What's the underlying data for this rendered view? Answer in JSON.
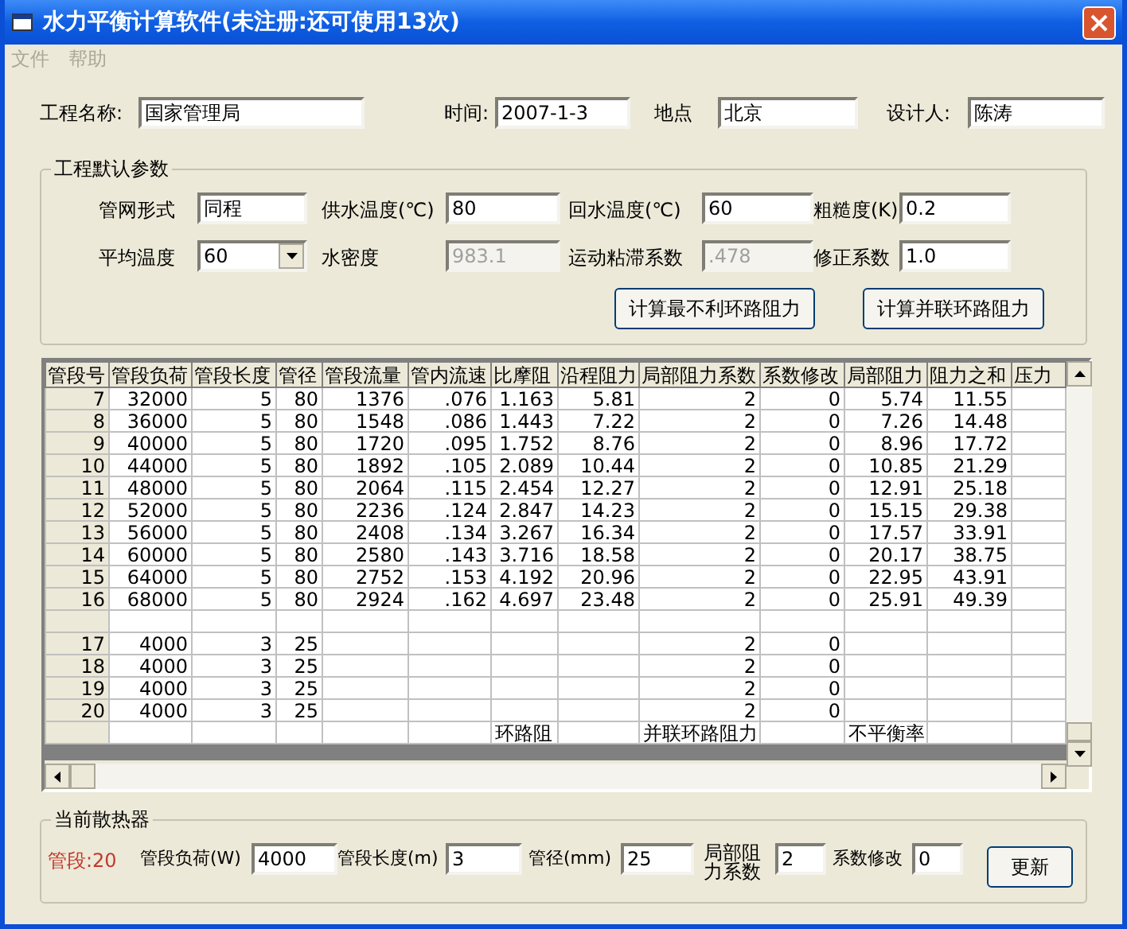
{
  "window": {
    "title": "水力平衡计算软件(未注册:还可使用13次)"
  },
  "menu": [
    {
      "label": "文件",
      "disabled": true
    },
    {
      "label": "帮助",
      "disabled": true
    }
  ],
  "project": [
    {
      "label": "工程名称:",
      "value": "国家管理局"
    },
    {
      "label": "时间:",
      "value": "2007-1-3"
    },
    {
      "label": "地点",
      "value": "北京"
    },
    {
      "label": "设计人:",
      "value": "陈涛"
    }
  ],
  "defaults": {
    "title": "工程默认参数",
    "fields": [
      {
        "kind": "text",
        "label": "管网形式",
        "value": "同程",
        "disabled": false
      },
      {
        "kind": "text",
        "label": "供水温度(℃)",
        "value": "80",
        "disabled": false
      },
      {
        "kind": "text",
        "label": "回水温度(℃)",
        "value": "60",
        "disabled": false
      },
      {
        "kind": "text",
        "label": "粗糙度(K)",
        "value": "0.2",
        "disabled": false
      },
      {
        "kind": "select",
        "label": "平均温度",
        "value": "60",
        "disabled": false
      },
      {
        "kind": "text",
        "label": "水密度",
        "value": "983.1",
        "disabled": true
      },
      {
        "kind": "text",
        "label": "运动粘滞系数",
        "value": ".478",
        "disabled": true
      },
      {
        "kind": "text",
        "label": "修正系数",
        "value": "1.0",
        "disabled": false
      }
    ],
    "buttons": [
      "计算最不利环路阻力",
      "计算并联环路阻力"
    ]
  },
  "table": {
    "columns": [
      "管段号",
      "管段负荷",
      "管段长度",
      "管径",
      "管段流量",
      "管内流速",
      "比摩阻",
      "沿程阻力",
      "局部阻力系数",
      "系数修改",
      "局部阻力",
      "阻力之和",
      "压力"
    ],
    "rows": [
      [
        "7",
        "32000",
        "5",
        "80",
        "1376",
        ".076",
        "1.163",
        "5.81",
        "2",
        "0",
        "5.74",
        "11.55",
        null
      ],
      [
        "8",
        "36000",
        "5",
        "80",
        "1548",
        ".086",
        "1.443",
        "7.22",
        "2",
        "0",
        "7.26",
        "14.48",
        null
      ],
      [
        "9",
        "40000",
        "5",
        "80",
        "1720",
        ".095",
        "1.752",
        "8.76",
        "2",
        "0",
        "8.96",
        "17.72",
        null
      ],
      [
        "10",
        "44000",
        "5",
        "80",
        "1892",
        ".105",
        "2.089",
        "10.44",
        "2",
        "0",
        "10.85",
        "21.29",
        null
      ],
      [
        "11",
        "48000",
        "5",
        "80",
        "2064",
        ".115",
        "2.454",
        "12.27",
        "2",
        "0",
        "12.91",
        "25.18",
        null
      ],
      [
        "12",
        "52000",
        "5",
        "80",
        "2236",
        ".124",
        "2.847",
        "14.23",
        "2",
        "0",
        "15.15",
        "29.38",
        null
      ],
      [
        "13",
        "56000",
        "5",
        "80",
        "2408",
        ".134",
        "3.267",
        "16.34",
        "2",
        "0",
        "17.57",
        "33.91",
        null
      ],
      [
        "14",
        "60000",
        "5",
        "80",
        "2580",
        ".143",
        "3.716",
        "18.58",
        "2",
        "0",
        "20.17",
        "38.75",
        null
      ],
      [
        "15",
        "64000",
        "5",
        "80",
        "2752",
        ".153",
        "4.192",
        "20.96",
        "2",
        "0",
        "22.95",
        "43.91",
        null
      ],
      [
        "16",
        "68000",
        "5",
        "80",
        "2924",
        ".162",
        "4.697",
        "23.48",
        "2",
        "0",
        "25.91",
        "49.39",
        null
      ],
      [
        null,
        null,
        null,
        null,
        null,
        null,
        null,
        null,
        null,
        null,
        null,
        null,
        null
      ],
      [
        "17",
        "4000",
        "3",
        "25",
        null,
        null,
        null,
        null,
        "2",
        "0",
        null,
        null,
        null
      ],
      [
        "18",
        "4000",
        "3",
        "25",
        null,
        null,
        null,
        null,
        "2",
        "0",
        null,
        null,
        null
      ],
      [
        "19",
        "4000",
        "3",
        "25",
        null,
        null,
        null,
        null,
        "2",
        "0",
        null,
        null,
        null
      ],
      [
        "20",
        "4000",
        "3",
        "25",
        null,
        null,
        null,
        null,
        "2",
        "0",
        null,
        null,
        null
      ],
      [
        null,
        null,
        null,
        null,
        null,
        null,
        "环路阻",
        null,
        "并联环路阻力",
        null,
        "不平衡率",
        null,
        null
      ]
    ]
  },
  "current": {
    "title": "当前散热器",
    "segment": "管段:20",
    "fields": [
      {
        "kind": "single",
        "label": "管段负荷(W)",
        "value": "4000"
      },
      {
        "kind": "single",
        "label": "管段长度(m)",
        "value": "3"
      },
      {
        "kind": "single",
        "label": "管径(mm)",
        "value": "25"
      },
      {
        "kind": "double",
        "label": "局部阻力系数",
        "value": "2"
      },
      {
        "kind": "single",
        "label": "系数修改",
        "value": "0"
      }
    ],
    "button": "更新"
  }
}
